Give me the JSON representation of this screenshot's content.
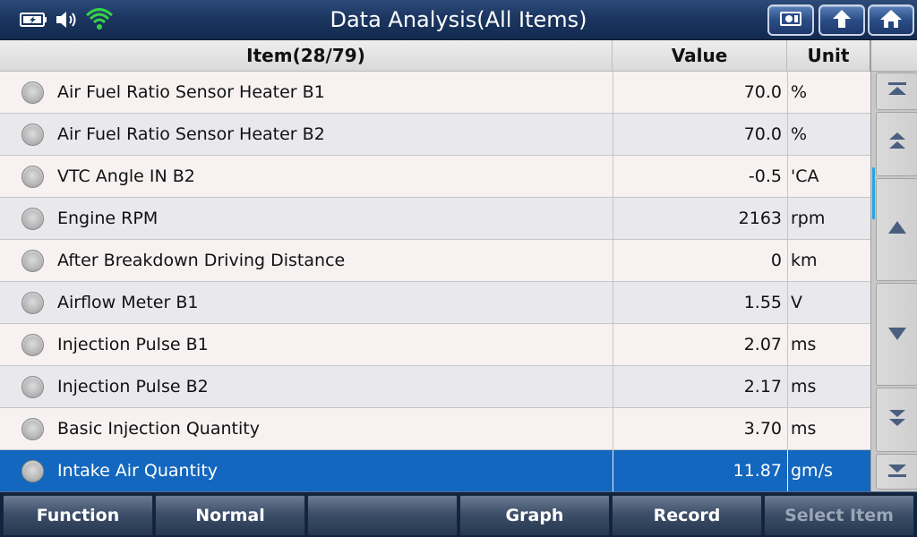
{
  "header": {
    "title": "Data Analysis(All Items)",
    "status_icons": [
      "battery-charging-icon",
      "volume-icon",
      "wifi-icon"
    ],
    "buttons": [
      "screenshot-icon",
      "back-arrow-icon",
      "home-icon"
    ]
  },
  "table": {
    "columns": {
      "item": "Item(28/79)",
      "value": "Value",
      "unit": "Unit"
    },
    "rows": [
      {
        "name": "Air Fuel Ratio Sensor Heater B1",
        "value": "70.0",
        "unit": "%"
      },
      {
        "name": "Air Fuel Ratio Sensor Heater B2",
        "value": "70.0",
        "unit": "%"
      },
      {
        "name": "VTC Angle IN B2",
        "value": "-0.5",
        "unit": "'CA"
      },
      {
        "name": "Engine RPM",
        "value": "2163",
        "unit": "rpm"
      },
      {
        "name": "After Breakdown Driving Distance",
        "value": "0",
        "unit": "km"
      },
      {
        "name": "Airflow Meter B1",
        "value": "1.55",
        "unit": "V"
      },
      {
        "name": "Injection Pulse B1",
        "value": "2.07",
        "unit": "ms"
      },
      {
        "name": "Injection Pulse B2",
        "value": "2.17",
        "unit": "ms"
      },
      {
        "name": "Basic Injection Quantity",
        "value": "3.70",
        "unit": "ms"
      },
      {
        "name": "Intake Air Quantity",
        "value": "11.87",
        "unit": "gm/s",
        "selected": true
      }
    ]
  },
  "scroll": {
    "buttons": [
      "scroll-to-top-icon",
      "page-up-icon",
      "line-up-icon",
      "line-down-icon",
      "page-down-icon",
      "scroll-to-bottom-icon"
    ]
  },
  "footer": {
    "buttons": [
      {
        "label": "Function",
        "enabled": true
      },
      {
        "label": "Normal",
        "enabled": true
      },
      {
        "label": "",
        "enabled": true
      },
      {
        "label": "Graph",
        "enabled": true
      },
      {
        "label": "Record",
        "enabled": true
      },
      {
        "label": "Select Item",
        "enabled": false
      }
    ]
  },
  "colors": {
    "selected_row": "#1467be",
    "wifi": "#35d24a",
    "scroll_thumb": "#23a8e6"
  }
}
